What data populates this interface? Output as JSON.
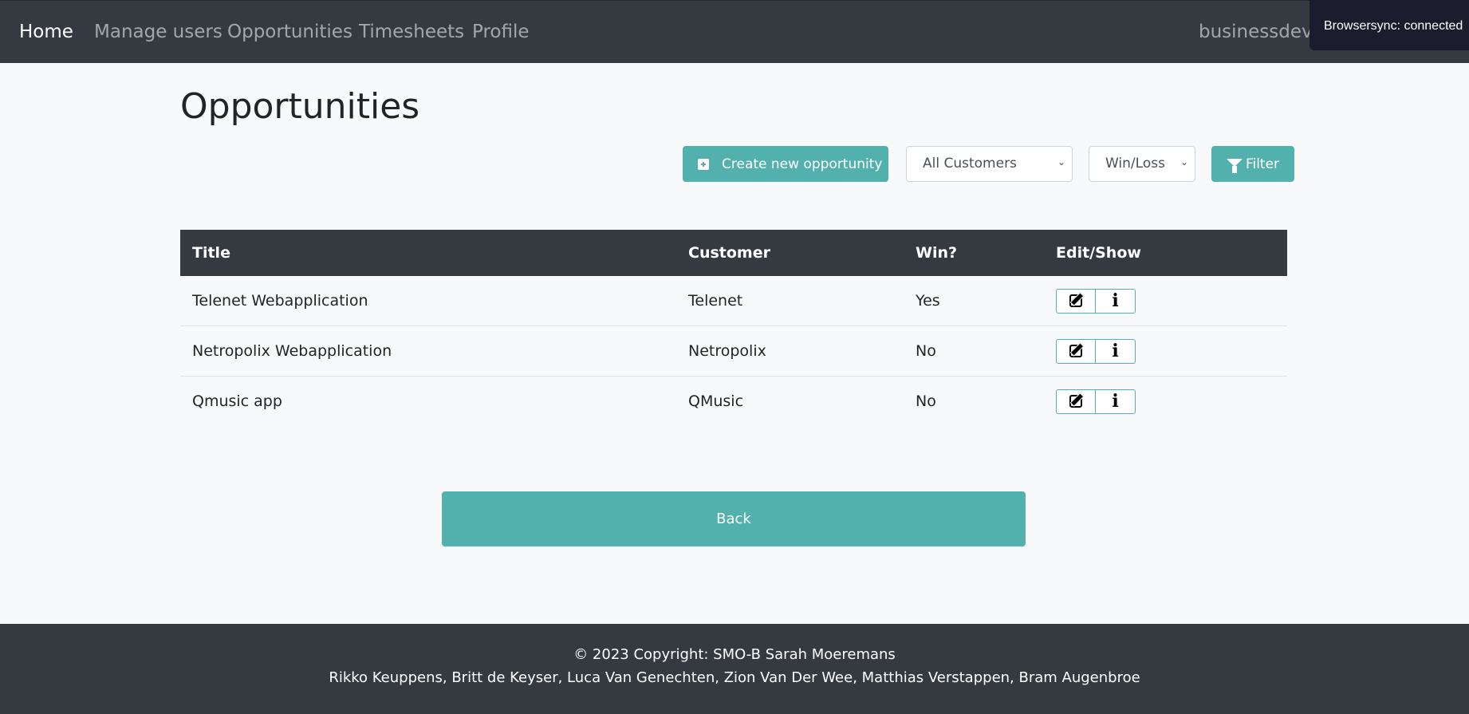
{
  "nav": {
    "items": [
      {
        "label": "Home",
        "active": true
      },
      {
        "label": "Manage users"
      },
      {
        "label": "Opportunities"
      },
      {
        "label": "Timesheets"
      },
      {
        "label": "Profile"
      }
    ],
    "user_label": "businessdev@"
  },
  "browsersync": "Browsersync: connected",
  "page_title": "Opportunities",
  "toolbar": {
    "create_label": "Create new opportunity",
    "customer_select": "All Customers",
    "winloss_select": "Win/Loss",
    "filter_label": "Filter"
  },
  "table": {
    "headers": [
      "Title",
      "Customer",
      "Win?",
      "Edit/Show"
    ],
    "rows": [
      {
        "title": "Telenet Webapplication",
        "customer": "Telenet",
        "win": "Yes"
      },
      {
        "title": "Netropolix Webapplication",
        "customer": "Netropolix",
        "win": "No"
      },
      {
        "title": "Qmusic app",
        "customer": "QMusic",
        "win": "No"
      }
    ]
  },
  "back_label": "Back",
  "footer": {
    "copyright": "© 2023 Copyright: SMO-B Sarah Moeremans",
    "authors": "Rikko Keuppens, Britt de Keyser, Luca Van Genechten, Zion Van Der Wee, Matthias Verstappen, Bram Augenbroe"
  },
  "colors": {
    "accent": "#52b0ad",
    "dark": "#343a40",
    "background": "#f8f9fa"
  }
}
